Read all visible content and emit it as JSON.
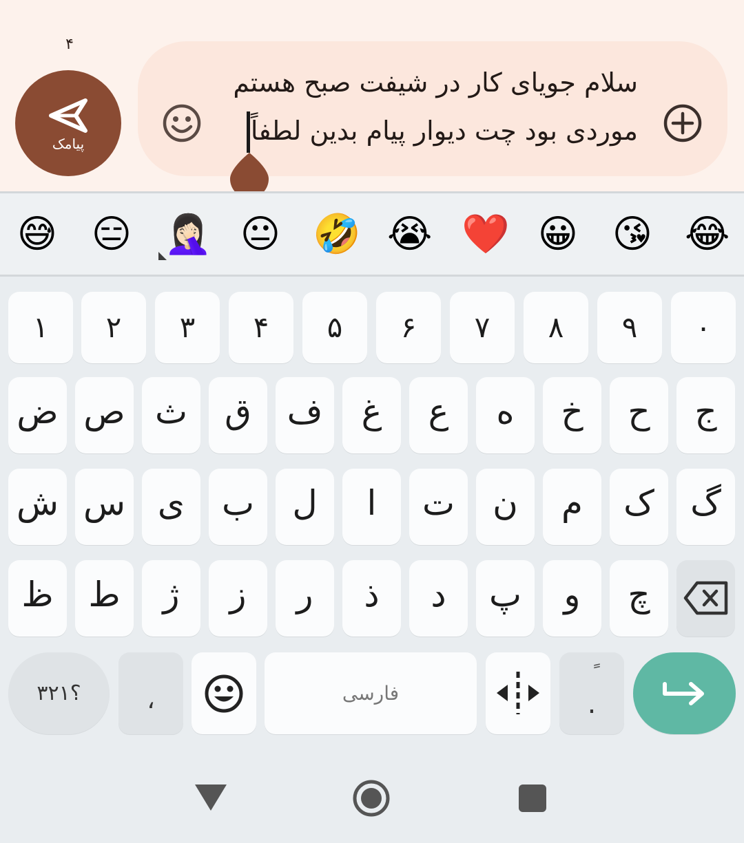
{
  "compose": {
    "char_count": "۴",
    "send_label": "پیامک",
    "message_line1": "سلام جویای کار در شیفت صبح هستم",
    "message_line2": "موردی بود چت دیوار پیام بدین لطفاً"
  },
  "emoji_suggestions": [
    "😅",
    "😑",
    "🤦🏻‍♀️",
    "😐",
    "🤣",
    "😭",
    "❤️",
    "😀",
    "😘",
    "😂"
  ],
  "keyboard": {
    "numbers": [
      "۱",
      "۲",
      "۳",
      "۴",
      "۵",
      "۶",
      "۷",
      "۸",
      "۹",
      "۰"
    ],
    "row1": [
      "ض",
      "ص",
      "ث",
      "ق",
      "ف",
      "غ",
      "ع",
      "ه",
      "خ",
      "ح",
      "ج"
    ],
    "row2": [
      "ش",
      "س",
      "ی",
      "ب",
      "ل",
      "ا",
      "ت",
      "ن",
      "م",
      "ک",
      "گ"
    ],
    "row3": [
      "ظ",
      "ط",
      "ژ",
      "ز",
      "ر",
      "ذ",
      "د",
      "پ",
      "و",
      "چ"
    ],
    "symbols_label": "؟۳۲۱",
    "comma_label": "،",
    "space_label": "فارسی",
    "period_label": ".",
    "ztwnj_label": "ً"
  },
  "colors": {
    "send_button": "#8a4b33",
    "enter_button": "#5fb8a4",
    "compose_bg": "#fdf2ec",
    "field_bg": "#fce7dd",
    "keyboard_bg": "#e9edf0"
  },
  "icons": {
    "send": "send-icon",
    "emoji_toggle": "smiley-icon",
    "attach": "plus-circle-icon",
    "backspace": "backspace-icon",
    "emoji_key": "smiley-icon",
    "cursor_move": "cursor-move-icon",
    "enter": "enter-arrow-icon",
    "back": "triangle-back-icon",
    "home": "circle-home-icon",
    "recents": "square-recents-icon"
  }
}
